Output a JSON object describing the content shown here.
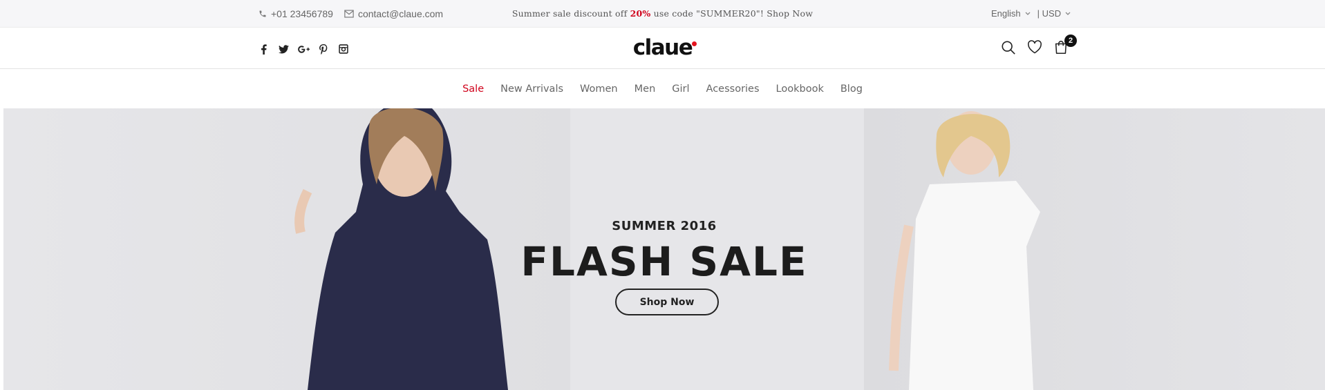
{
  "topbar": {
    "phone": "+01 23456789",
    "email": "contact@claue.com",
    "promo_before": "Summer sale discount off ",
    "promo_pct": "20%",
    "promo_after": " use code \"SUMMER20\"! Shop Now",
    "language": "English",
    "currency": "| USD"
  },
  "header": {
    "logo": "claue",
    "cart_count": "2",
    "social_icons": [
      "facebook-icon",
      "twitter-icon",
      "google-plus-icon",
      "pinterest-icon",
      "instagram-icon"
    ],
    "action_icons": [
      "search-icon",
      "heart-icon",
      "cart-icon"
    ]
  },
  "nav": {
    "items": [
      "Sale",
      "New Arrivals",
      "Women",
      "Men",
      "Girl",
      "Acessories",
      "Lookbook",
      "Blog"
    ],
    "active_color": "#d0021b"
  },
  "hero": {
    "subtitle": "SUMMER 2016",
    "title": "FLASH SALE",
    "button": "Shop Now"
  },
  "colors": {
    "accent": "#d0021b",
    "topbar_bg": "#f6f6f8",
    "hero_bg": "#e3e3e6"
  }
}
